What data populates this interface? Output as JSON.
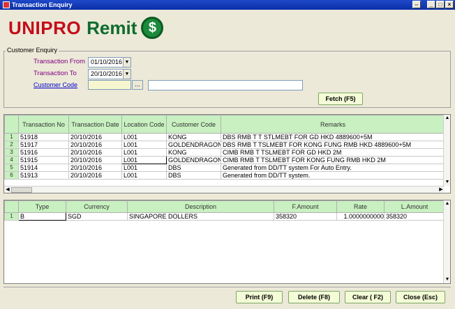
{
  "window": {
    "title": "Transaction Enquiry"
  },
  "logo": {
    "brand": "UNIPRO",
    "suffix": "Remit",
    "coin_symbol": "$"
  },
  "enquiry": {
    "group_label": "Customer Enquiry",
    "from_label": "Transaction From",
    "from_value": "01/10/2016",
    "to_label": "Transaction To",
    "to_value": "20/10/2016",
    "code_label": "Customer Code",
    "code_value": "",
    "ellipsis": "...",
    "name_value": "",
    "fetch_label": "Fetch (F5)"
  },
  "transactions": {
    "headers": [
      "Transaction No",
      "Transaction Date",
      "Location Code",
      "Customer Code",
      "Remarks"
    ],
    "rows": [
      {
        "rn": "1",
        "no": "51918",
        "date": "20/10/2016",
        "loc": "L001",
        "cust": "KONG",
        "remarks": "DBS RMB T T STLMEBT FOR GD HKD 4889600+5M"
      },
      {
        "rn": "2",
        "no": "51917",
        "date": "20/10/2016",
        "loc": "L001",
        "cust": "GOLDENDRAGON",
        "remarks": "DBS RMB T TSLMEBT FOR KONG FUNG RMB HKD 4889600+5M"
      },
      {
        "rn": "3",
        "no": "51916",
        "date": "20/10/2016",
        "loc": "L001",
        "cust": "KONG",
        "remarks": "CIMB RMB T TSLMEBT FOR GD HKD 2M"
      },
      {
        "rn": "4",
        "no": "51915",
        "date": "20/10/2016",
        "loc": "L001",
        "cust": "GOLDENDRAGON",
        "remarks": "CIMB RMB T TSLMEBT FOR KONG FUNG RMB HKD 2M"
      },
      {
        "rn": "5",
        "no": "51914",
        "date": "20/10/2016",
        "loc": "L001",
        "cust": "DBS",
        "remarks": "Generated from DD/TT system For Auto Entry."
      },
      {
        "rn": "6",
        "no": "51913",
        "date": "20/10/2016",
        "loc": "L001",
        "cust": "DBS",
        "remarks": "Generated from DD/TT system."
      }
    ]
  },
  "details": {
    "headers": [
      "Type",
      "Currency",
      "Description",
      "F.Amount",
      "Rate",
      "L.Amount"
    ],
    "rows": [
      {
        "rn": "1",
        "type": "B",
        "currency": "SGD",
        "desc": "SINGAPORE DOLLERS",
        "famount": "358320",
        "rate": "1.0000000000",
        "lamount": "358320"
      }
    ]
  },
  "footer": {
    "print_label": "Print (F9)",
    "delete_label": "Delete (F8)",
    "clear_label": "Clear ( F2)",
    "close_label": "Close (Esc)"
  },
  "colors": {
    "title_bar": "#0a2fa8",
    "header_green": "#c8f0c0",
    "button_bg": "#f3fcd7",
    "brand_red": "#c40d1a",
    "brand_green": "#0f6b2e"
  }
}
